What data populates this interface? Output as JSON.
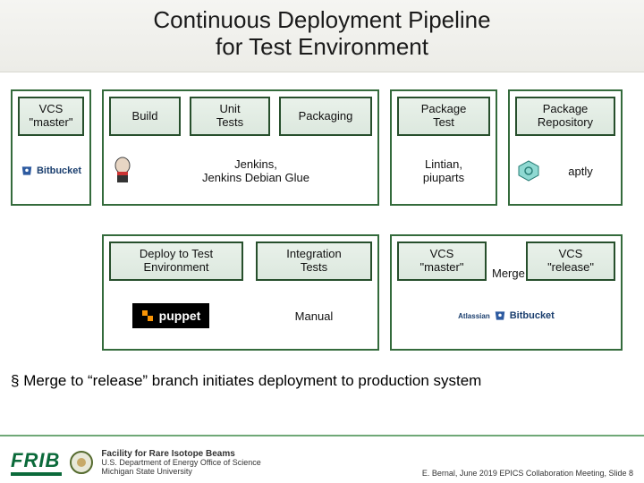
{
  "title_line1": "Continuous Deployment Pipeline",
  "title_line2": "for Test Environment",
  "row1": {
    "vcs": {
      "label": "VCS\n\"master\""
    },
    "build": {
      "label": "Build"
    },
    "unit": {
      "label": "Unit\nTests"
    },
    "pkg": {
      "label": "Packaging"
    },
    "ptest": {
      "label": "Package\nTest"
    },
    "repo": {
      "label": "Package\nRepository"
    },
    "jenkins_tool": "Jenkins,\nJenkins Debian Glue",
    "ptest_tool": "Lintian,\npiuparts",
    "repo_tool": "aptly"
  },
  "row2": {
    "deploy": {
      "label": "Deploy to Test\nEnvironment"
    },
    "itest": {
      "label": "Integration\nTests"
    },
    "vcs_master": "VCS\n\"master\"",
    "vcs_release": "VCS\n\"release\"",
    "merge": "Merge",
    "deploy_tool_manual": "Manual"
  },
  "bullet": "Merge to “release” branch initiates deployment to production system",
  "footer": {
    "frib": "FRIB",
    "line1": "Facility for Rare Isotope Beams",
    "line2": "U.S. Department of Energy Office of Science",
    "line3": "Michigan State University",
    "right": "E. Bernal, June 2019 EPICS Collaboration Meeting, Slide 8"
  },
  "icons": {
    "bitbucket_label": "Bitbucket",
    "atlassian_label": "Atlassian"
  }
}
